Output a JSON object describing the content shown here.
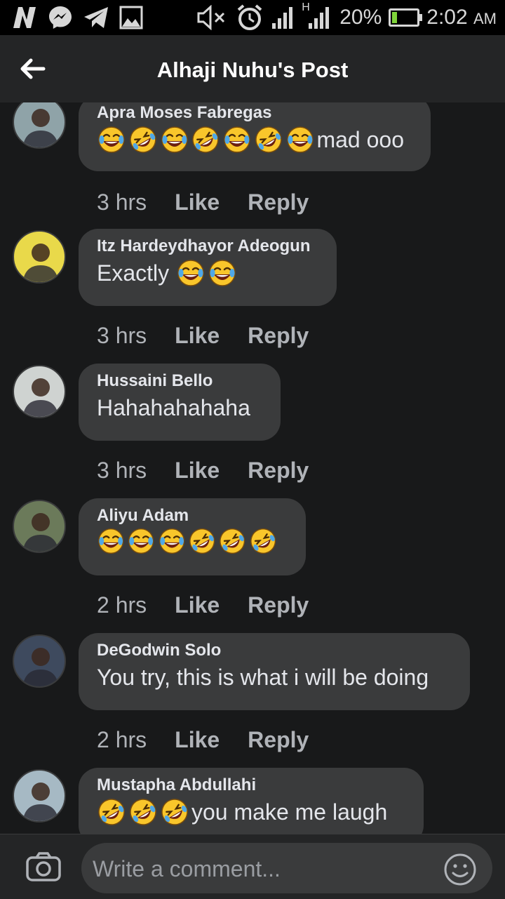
{
  "status_bar": {
    "battery_percent": "20%",
    "time": "2:02",
    "am_pm": "AM",
    "network_label": "H",
    "icons": [
      "n-icon",
      "messenger-icon",
      "telegram-icon",
      "gallery-icon",
      "mute-icon",
      "alarm-icon",
      "signal-icon",
      "battery-icon"
    ],
    "battery_level": 0.2,
    "battery_color": "#7fd33a"
  },
  "header": {
    "title": "Alhaji Nuhu's Post",
    "back_icon": "back-arrow-icon"
  },
  "comments": [
    {
      "name": "Apra Moses Fabregas",
      "emojis": [
        "joy",
        "rofl",
        "joy",
        "rofl",
        "joy",
        "rofl",
        "joy"
      ],
      "text": "mad ooo",
      "time": "3 hrs",
      "like": "Like",
      "reply": "Reply",
      "avatar_color": "#8fa3a8"
    },
    {
      "name": "Itz Hardeydhayor Adeogun",
      "emojis": [],
      "text": "Exactly",
      "trailing_emojis": [
        "joy",
        "joy"
      ],
      "time": "3 hrs",
      "like": "Like",
      "reply": "Reply",
      "avatar_color": "#e9d94a"
    },
    {
      "name": "Hussaini Bello",
      "emojis": [],
      "text": "Hahahahahaha",
      "time": "3 hrs",
      "like": "Like",
      "reply": "Reply",
      "avatar_color": "#cfd3d1"
    },
    {
      "name": "Aliyu Adam",
      "emojis": [
        "joy",
        "joy",
        "joy",
        "rofl",
        "rofl",
        "rofl"
      ],
      "text": "",
      "time": "2 hrs",
      "like": "Like",
      "reply": "Reply",
      "avatar_color": "#6b7a5a"
    },
    {
      "name": "DeGodwin Solo",
      "emojis": [],
      "text": "You try, this is what i will be doing",
      "time": "2 hrs",
      "like": "Like",
      "reply": "Reply",
      "avatar_color": "#3e4a5e"
    },
    {
      "name": "Mustapha Abdullahi",
      "emojis": [
        "rofl",
        "rofl",
        "rofl"
      ],
      "text": " you make me laugh",
      "time": "",
      "like": "",
      "reply": "",
      "avatar_color": "#a6b9c4"
    }
  ],
  "composer": {
    "placeholder": "Write a comment...",
    "camera_icon": "camera-icon",
    "emoji_icon": "smiley-icon"
  },
  "colors": {
    "background": "#18191a",
    "bubble": "#3a3b3c",
    "header": "#242526",
    "emoji_face": "#f9c62b",
    "tear": "#4fa8e8"
  }
}
